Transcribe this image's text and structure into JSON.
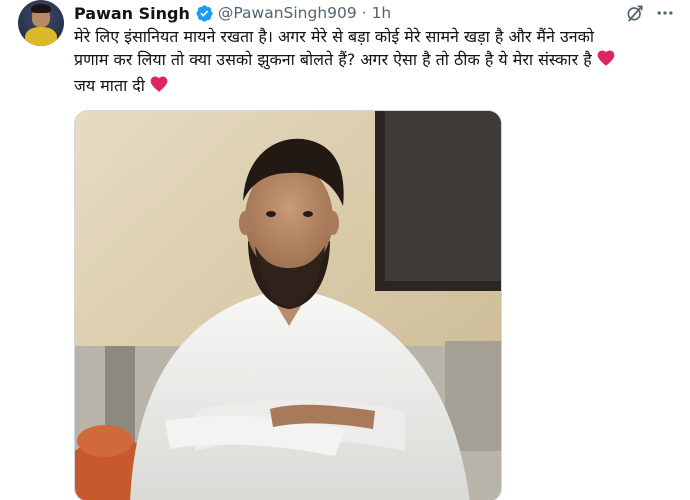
{
  "author": {
    "display_name": "Pawan Singh",
    "handle": "@PawanSingh909",
    "separator": "·",
    "time": "1h",
    "verified": true
  },
  "tweet": {
    "lines": [
      "मेरे लिए इंसानियत मायने रखता है। अगर मेरे से बड़ा कोई मेरे सामने खड़ा है और मैंने उनको",
      "प्रणाम कर लिया तो क्या उसको झुकना बोलते हैं? अगर ऐसा है तो ठीक है ये मेरा संस्कार है",
      "जय माता दी"
    ],
    "emoji": "red-heart"
  },
  "icons": {
    "grok": "grok-icon",
    "more": "more-options-icon",
    "verified": "verified-badge-icon"
  },
  "colors": {
    "verified_blue": "#1d9bf0",
    "heart_red": "#e0245e",
    "secondary_text": "#536471"
  }
}
